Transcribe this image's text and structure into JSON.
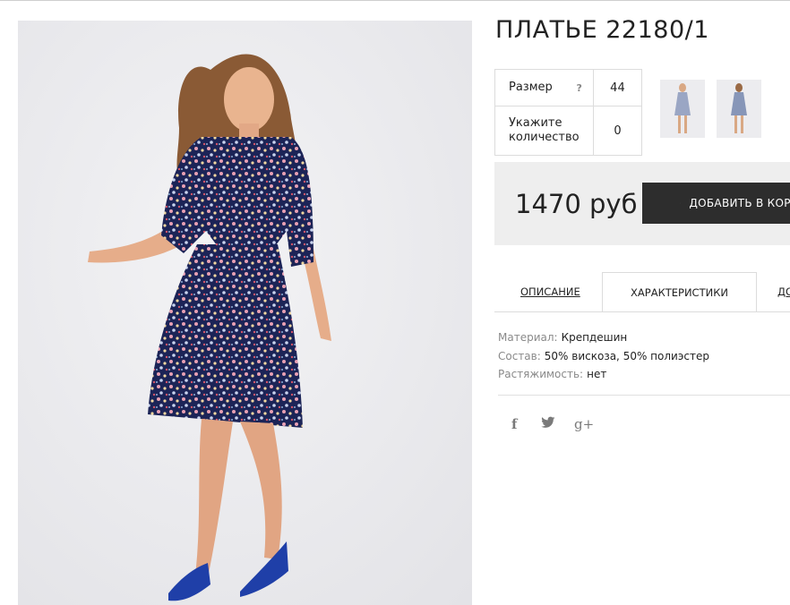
{
  "product": {
    "title": "ПЛАТЬЕ 22180/1"
  },
  "options": {
    "size_label": "Размер",
    "size_help": "?",
    "size_value": "44",
    "qty_label": "Укажите количество",
    "qty_value": "0"
  },
  "thumbnails": [
    "dress-thumbnail-1",
    "dress-thumbnail-2"
  ],
  "purchase": {
    "price": "1470 руб",
    "add_button": "ДОБАВИТЬ В КОРЗИНУ",
    "icon": "shopping-bag-icon"
  },
  "tabs": {
    "description": "ОПИСАНИЕ",
    "characteristics": "ХАРАКТЕРИСТИКИ",
    "more": "ДОСТАВКА"
  },
  "specs": [
    {
      "label": "Материал:",
      "value": "Крепдешин"
    },
    {
      "label": "Состав:",
      "value": "50% вискоза, 50% полиэстер"
    },
    {
      "label": "Растяжимость:",
      "value": "нет"
    }
  ],
  "social": {
    "facebook": "f",
    "twitter": "twitter-bird-icon",
    "google_plus": "g+"
  },
  "colors": {
    "button": "#2d2d2d",
    "price_bg": "#eeeeee",
    "dress": "#1c2457",
    "shoes": "#1f3fa8"
  }
}
